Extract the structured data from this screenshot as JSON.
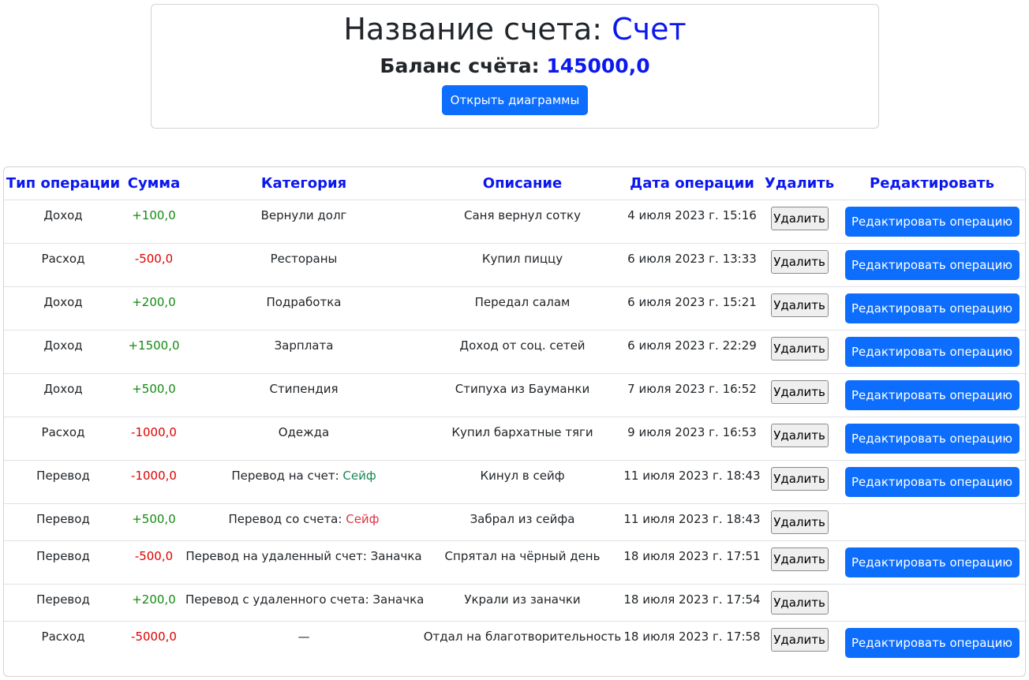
{
  "account": {
    "title_label": "Название счета:",
    "title_value": "Счет",
    "balance_label": "Баланс счёта:",
    "balance_value": "145000,0",
    "open_charts_label": "Открыть диаграммы",
    "accent_color": "#0b18ee"
  },
  "table": {
    "headers": [
      "Тип операции",
      "Сумма",
      "Категория",
      "Описание",
      "Дата операции",
      "Удалить",
      "Редактировать"
    ],
    "delete_label": "Удалить",
    "edit_label": "Редактировать операцию",
    "rows": [
      {
        "type": "Доход",
        "amount": "+100,0",
        "sign": "pos",
        "category": "Вернули долг",
        "description": "Саня вернул сотку",
        "date": "4 июля 2023 г. 15:16",
        "editable": true
      },
      {
        "type": "Расход",
        "amount": "-500,0",
        "sign": "neg",
        "category": "Рестораны",
        "description": "Купил пиццу",
        "date": "6 июля 2023 г. 13:33",
        "editable": true
      },
      {
        "type": "Доход",
        "amount": "+200,0",
        "sign": "pos",
        "category": "Подработка",
        "description": "Передал салам",
        "date": "6 июля 2023 г. 15:21",
        "editable": true
      },
      {
        "type": "Доход",
        "amount": "+1500,0",
        "sign": "pos",
        "category": "Зарплата",
        "description": "Доход от соц. сетей",
        "date": "6 июля 2023 г. 22:29",
        "editable": true
      },
      {
        "type": "Доход",
        "amount": "+500,0",
        "sign": "pos",
        "category": "Стипендия",
        "description": "Стипуха из Бауманки",
        "date": "7 июля 2023 г. 16:52",
        "editable": true
      },
      {
        "type": "Расход",
        "amount": "-1000,0",
        "sign": "neg",
        "category": "Одежда",
        "description": "Купил бархатные тяги",
        "date": "9 июля 2023 г. 16:53",
        "editable": true
      },
      {
        "type": "Перевод",
        "amount": "-1000,0",
        "sign": "neg",
        "category": "Перевод на счет:",
        "category_link": "Сейф",
        "link_color": "green",
        "description": "Кинул в сейф",
        "date": "11 июля 2023 г. 18:43",
        "editable": true
      },
      {
        "type": "Перевод",
        "amount": "+500,0",
        "sign": "pos",
        "category": "Перевод со счета:",
        "category_link": "Сейф",
        "link_color": "red",
        "description": "Забрал из сейфа",
        "date": "11 июля 2023 г. 18:43",
        "editable": false
      },
      {
        "type": "Перевод",
        "amount": "-500,0",
        "sign": "neg",
        "category": "Перевод на удаленный счет: Заначка",
        "description": "Спрятал на чёрный день",
        "date": "18 июля 2023 г. 17:51",
        "editable": true
      },
      {
        "type": "Перевод",
        "amount": "+200,0",
        "sign": "pos",
        "category": "Перевод с удаленного счета: Заначка",
        "description": "Украли из заначки",
        "date": "18 июля 2023 г. 17:54",
        "editable": false
      },
      {
        "type": "Расход",
        "amount": "-5000,0",
        "sign": "neg",
        "category": "—",
        "description": "Отдал на благотворительность",
        "date": "18 июля 2023 г. 17:58",
        "editable": true
      }
    ]
  }
}
